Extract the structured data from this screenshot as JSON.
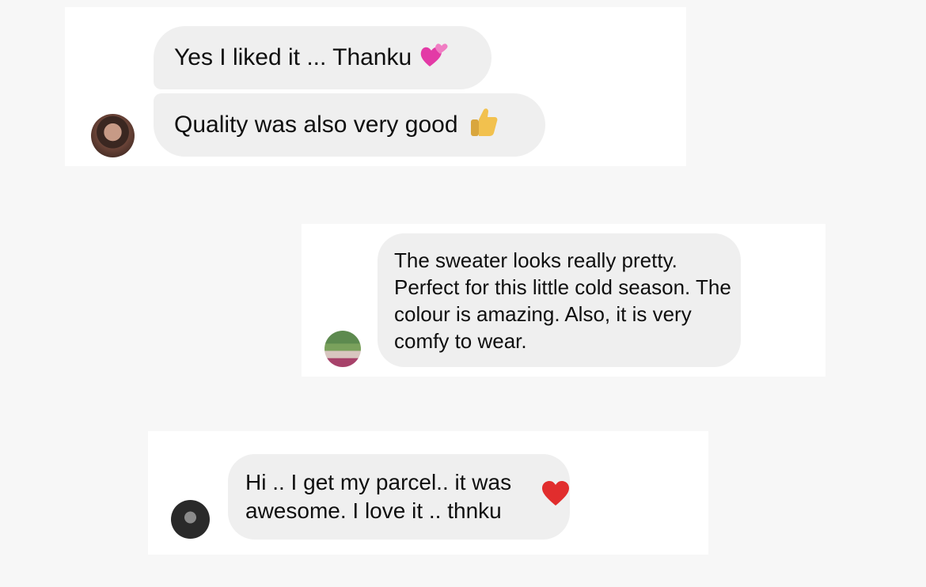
{
  "conversations": [
    {
      "avatar_label": "customer-avatar-1",
      "messages": [
        {
          "text": "Yes I liked it ... Thanku",
          "emoji": "two-hearts-icon"
        },
        {
          "text": "Quality was also very good",
          "emoji": "thumbs-up-icon"
        }
      ]
    },
    {
      "avatar_label": "customer-avatar-2",
      "messages": [
        {
          "text": "The sweater looks really pretty. Perfect for this little cold season. The colour is amazing. Also, it is very comfy to wear.",
          "emoji": ""
        }
      ]
    },
    {
      "avatar_label": "customer-avatar-3",
      "messages": [
        {
          "text": "Hi .. I get my parcel.. it was awesome. I love it .. thnku",
          "emoji": "red-heart-icon"
        }
      ]
    }
  ],
  "colors": {
    "page_background": "#f7f7f7",
    "card_background": "#ffffff",
    "bubble_background": "#efefef",
    "text": "#0f0f0f"
  }
}
